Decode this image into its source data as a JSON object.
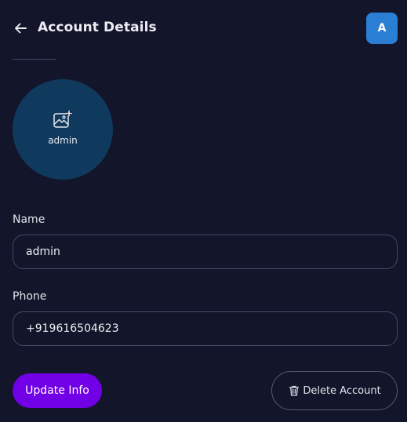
{
  "header": {
    "title": "Account Details",
    "avatar_initial": "A"
  },
  "profile": {
    "photo_label": "admin"
  },
  "form": {
    "name_label": "Name",
    "name_value": "admin",
    "phone_label": "Phone",
    "phone_value": "+919616504623"
  },
  "actions": {
    "update_label": "Update Info",
    "delete_label": "Delete Account"
  },
  "colors": {
    "background": "#13152a",
    "avatar": "#2a7fd4",
    "photo_circle": "#0f3a5e",
    "primary_button": "#7200e6"
  },
  "icons": {
    "back": "arrow-left-icon",
    "photo": "image-add-icon",
    "delete": "trash-icon"
  }
}
